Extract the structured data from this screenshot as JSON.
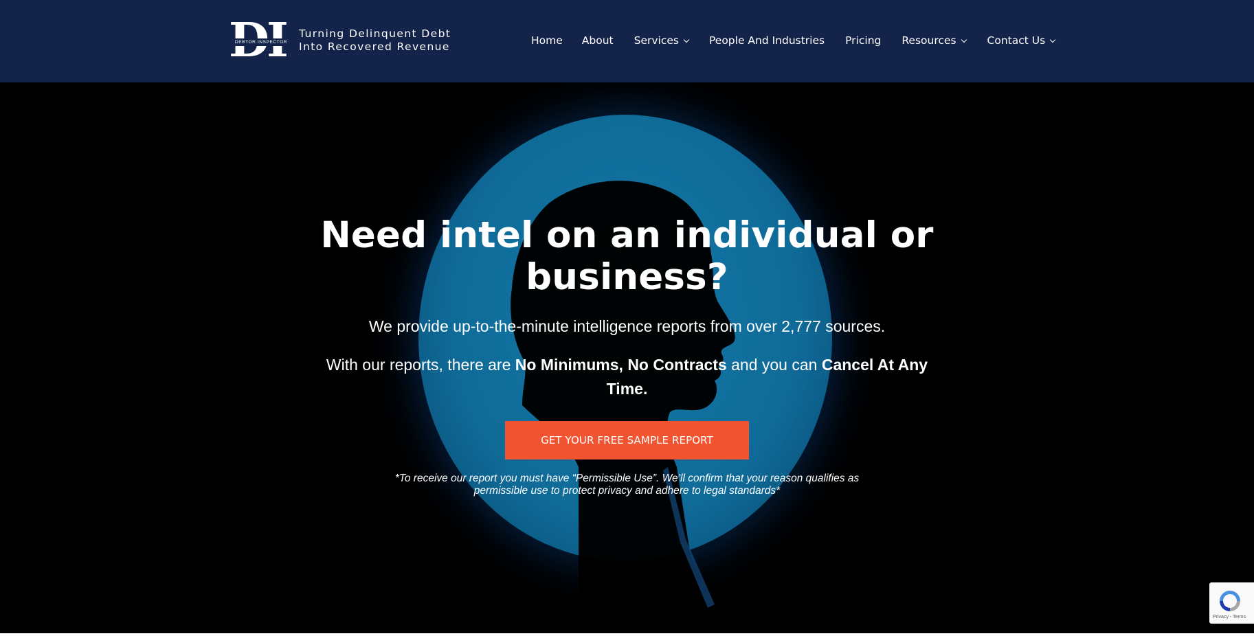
{
  "brand": {
    "logo_letters": "DI",
    "logo_band_text": "DEBTOR INSPECTOR",
    "tagline_line1": "Turning Delinquent Debt",
    "tagline_line2": "Into Recovered Revenue",
    "header_bg": "#14234a"
  },
  "nav": {
    "home": "Home",
    "about": "About",
    "services": "Services",
    "people_industries": "People And Industries",
    "pricing": "Pricing",
    "resources": "Resources",
    "contact": "Contact Us"
  },
  "hero": {
    "headline": "Need intel on an individual or business?",
    "subline": "We provide up-to-the-minute intelligence reports from over 2,777 sources.",
    "terms_prefix": "With our reports, there are ",
    "terms_bold1": "No Minimums, No Contracts",
    "terms_middle": " and you can ",
    "terms_bold2": "Cancel At Any Time.",
    "cta_label": "GET YOUR FREE SAMPLE REPORT",
    "cta_color": "#f05431",
    "disclaimer": "*To receive our report you must have “Permissible Use”. We’ll confirm that your reason qualifies as permissible use to protect privacy and adhere to legal standards*",
    "accent_circle_color": "#1479a8"
  },
  "recaptcha": {
    "links": "Privacy - Terms"
  }
}
